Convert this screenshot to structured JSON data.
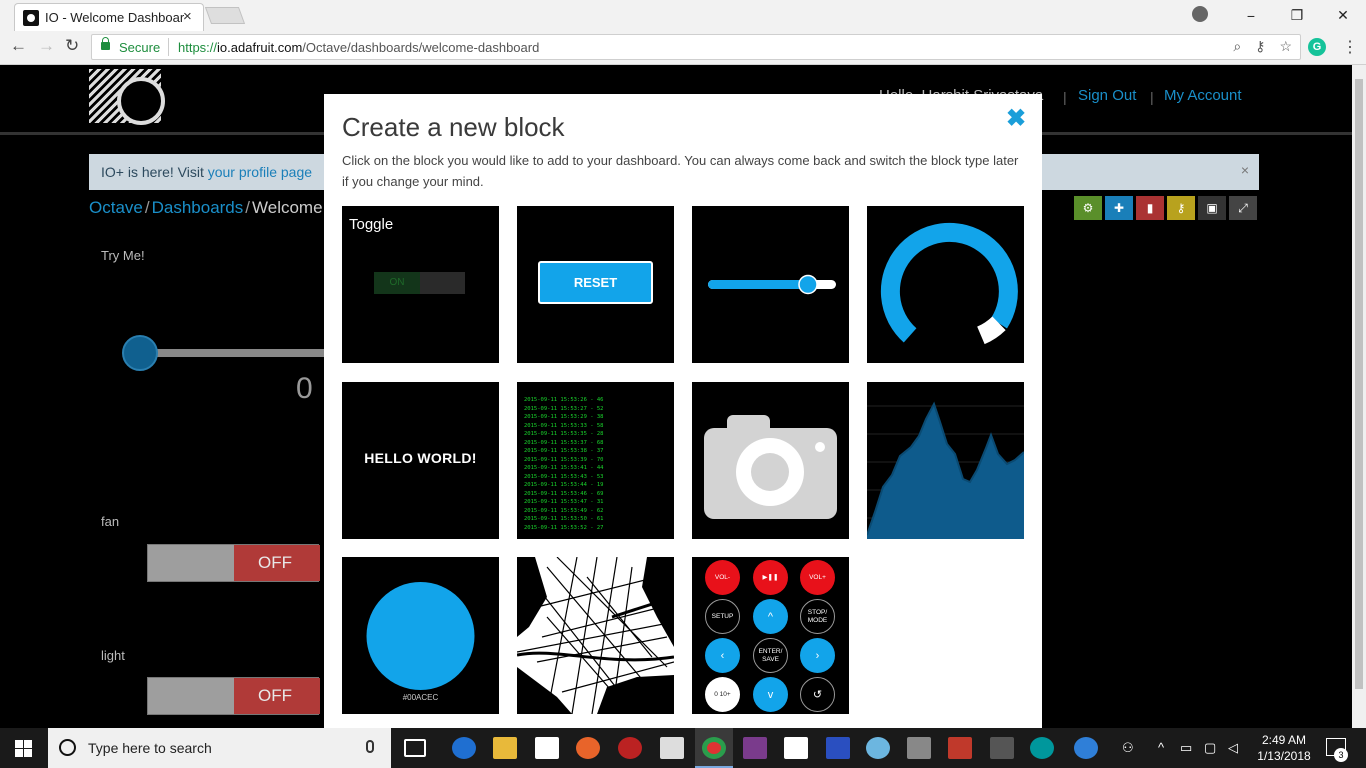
{
  "browser": {
    "tab_title": "IO - Welcome Dashboard",
    "tab_close": "×",
    "secure_label": "Secure",
    "url_protocol": "https://",
    "url_host": "io.adafruit.com",
    "url_path": "/Octave/dashboards/welcome-dashboard",
    "window_controls": [
      "−",
      "❐",
      "✕"
    ],
    "grammarly": "G"
  },
  "page": {
    "greeting": "Hello, Harshit Srivastava",
    "sign_out": "Sign Out",
    "my_account": "My Account",
    "header_separator": "|",
    "banner_prefix": "IO+ is here! Visit ",
    "banner_link": "your profile page",
    "banner_close": "×",
    "breadcrumb": [
      "Octave",
      "Dashboards",
      "Welcome Dashboard"
    ],
    "breadcrumb_sep": "/",
    "blocks_behind": {
      "try_me": "Try Me!",
      "slider_value": "0",
      "fan_label": "fan",
      "fan_state": "OFF",
      "light_label": "light",
      "light_state": "OFF"
    },
    "tool_colors": [
      "#5a8f2a",
      "#1a7fb9",
      "#a33",
      "#b8a21e",
      "#333",
      "#444"
    ]
  },
  "modal": {
    "title": "Create a new block",
    "close_icon": "✖",
    "description": "Click on the block you would like to add to your dashboard. You can always come back and switch the block type later if you change your mind.",
    "toggle_title": "Toggle",
    "toggle_on": "ON",
    "reset_label": "RESET",
    "text_block": "HELLO WORLD!",
    "color_label": "#00ACEC",
    "stream_lines": [
      "2015-09-11 15:53:26 - 46",
      "2015-09-11 15:53:27 - 52",
      "2015-09-11 15:53:29 - 38",
      "2015-09-11 15:53:33 - 58",
      "2015-09-11 15:53:35 - 28",
      "2015-09-11 15:53:37 - 68",
      "2015-09-11 15:53:38 - 37",
      "2015-09-11 15:53:39 - 70",
      "2015-09-11 15:53:41 - 44",
      "2015-09-11 15:53:43 - 53",
      "2015-09-11 15:53:44 - 19",
      "2015-09-11 15:53:46 - 69",
      "2015-09-11 15:53:47 - 31",
      "2015-09-11 15:53:49 - 62",
      "2015-09-11 15:53:50 - 61",
      "2015-09-11 15:53:52 - 27"
    ],
    "remote": {
      "vol_down": "VOL-",
      "play_pause": "▶❚❚",
      "vol_up": "VOL+",
      "setup": "SETUP",
      "up": "^",
      "stop_mode": "STOP/ MODE",
      "left": "‹",
      "enter_save": "ENTER/ SAVE",
      "right": "›",
      "zero": "0 10+",
      "down": "v",
      "back": "↺"
    }
  },
  "taskbar": {
    "search_placeholder": "Type here to search",
    "time": "2:49 AM",
    "date": "1/13/2018",
    "notifications": "3"
  }
}
